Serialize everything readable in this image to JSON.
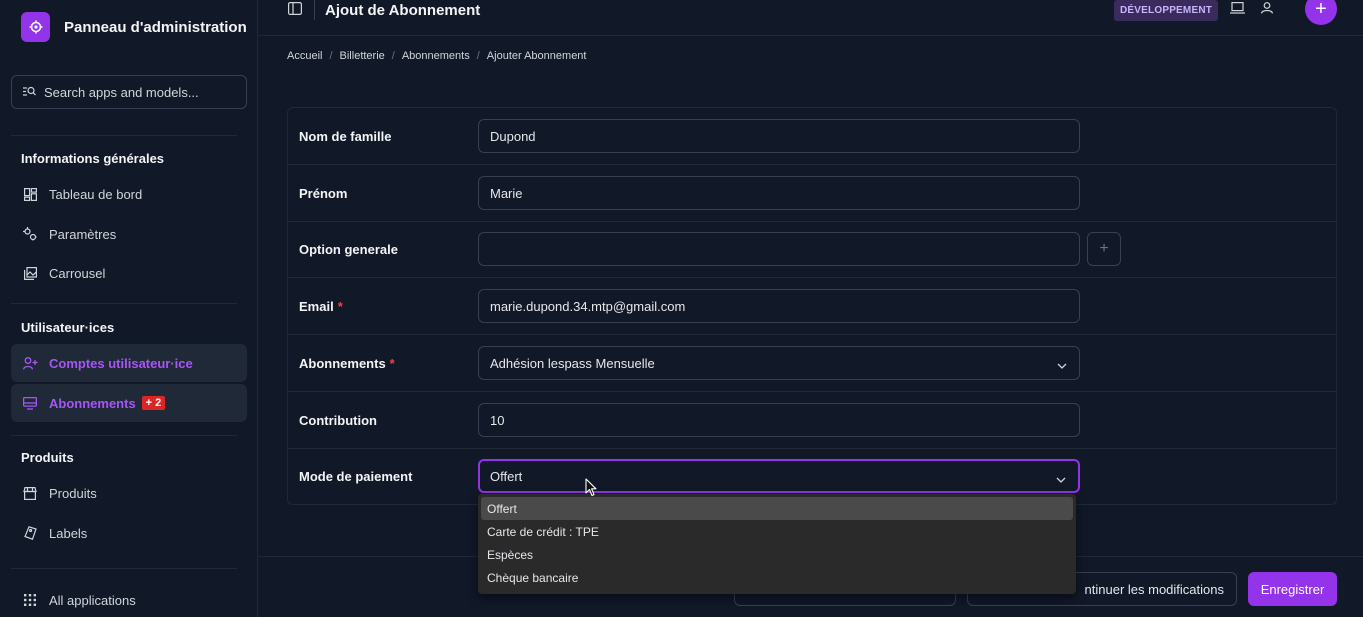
{
  "sidebar": {
    "brand_title": "Panneau d'administration",
    "search_placeholder": "Search apps and models...",
    "sections": [
      {
        "title": "Informations générales",
        "items": [
          "Tableau de bord",
          "Paramètres",
          "Carrousel"
        ]
      },
      {
        "title": "Utilisateur·ices",
        "items": [
          "Comptes utilisateur·ice",
          "Abonnements"
        ]
      },
      {
        "title": "Produits",
        "items": [
          "Produits",
          "Labels"
        ]
      }
    ],
    "abonnements_badge": "+ 2",
    "all_apps": "All applications"
  },
  "header": {
    "title": "Ajout de Abonnement",
    "env_badge": "DÉVELOPPEMENT"
  },
  "breadcrumb": [
    "Accueil",
    "Billetterie",
    "Abonnements",
    "Ajouter Abonnement"
  ],
  "form": {
    "nom_label": "Nom de famille",
    "nom_value": "Dupond",
    "prenom_label": "Prénom",
    "prenom_value": "Marie",
    "option_label": "Option generale",
    "option_value": "",
    "email_label": "Email",
    "email_value": "marie.dupond.34.mtp@gmail.com",
    "abonnements_label": "Abonnements",
    "abonnements_value": "Adhésion lespass Mensuelle",
    "contribution_label": "Contribution",
    "contribution_value": "10",
    "paiement_label": "Mode de paiement",
    "paiement_value": "Offert",
    "required_mark": "*"
  },
  "dropdown": {
    "options": [
      "Offert",
      "Carte de crédit : TPE",
      "Espèces",
      "Chèque bancaire"
    ],
    "selected_index": 0
  },
  "footer": {
    "continue_label": "ntinuer les modifications",
    "save_label": "Enregistrer"
  },
  "colors": {
    "accent": "#9333ea",
    "background": "#111827",
    "badge_red": "#dc2626"
  }
}
